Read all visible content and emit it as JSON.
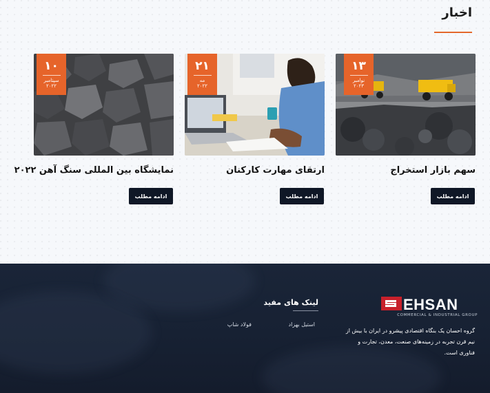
{
  "news": {
    "title": "اخبار",
    "cards": [
      {
        "title": "سهم بازار استخراج",
        "day": "۱۳",
        "month": "نوامبر",
        "year": "۲۰۲۳",
        "button": "ادامه مطلب",
        "image": "mining-trucks"
      },
      {
        "title": "ارتقای مهارت کارکنان",
        "day": "۲۱",
        "month": "مه",
        "year": "۲۰۲۲",
        "button": "ادامه مطلب",
        "image": "person-writing-laptop"
      },
      {
        "title": "نمایشگاه بین المللی سنگ آهن ۲۰۲۲",
        "day": "۱۰",
        "month": "سپتامبر",
        "year": "۲۰۲۲",
        "button": "ادامه مطلب",
        "image": "iron-ore-rocks"
      }
    ]
  },
  "footer": {
    "logo_text": "EHSAN",
    "logo_subtitle": "COMMERCIAL & INDUSTRIAL GROUP",
    "about": "گروه احسان یک بنگاه اقتصادی پیشرو در ایران با بیش از نیم قرن تجربه در زمینه‌های صنعت، معدن، تجارت و فناوری است.",
    "links_title": "لینک های مفید",
    "links": [
      "استیل بهزاد",
      "فولاد شاپ"
    ],
    "accent": "#c8202b"
  },
  "colors": {
    "accent": "#e6642a",
    "button": "#0f1726",
    "footer": "#172133"
  }
}
